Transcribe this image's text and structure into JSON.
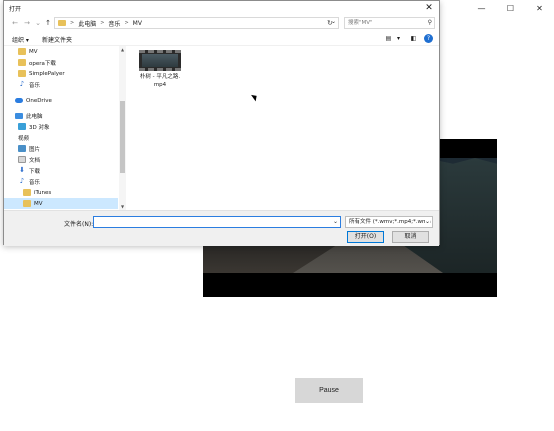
{
  "app": {
    "window_controls": [
      "—",
      "☐",
      "✕"
    ],
    "pause_label": "Pause"
  },
  "dialog": {
    "title": "打开",
    "close_glyph": "✕",
    "nav": {
      "back": "←",
      "forward": "→",
      "recent": "⌄",
      "up": "↑"
    },
    "address": {
      "crumbs": [
        "此电脑",
        "音乐",
        "MV"
      ],
      "sep": ">"
    },
    "refresh": "↻",
    "search_placeholder": "搜索\"MV\"",
    "toolbar": {
      "organize": "组织 ▾",
      "new_folder": "新建文件夹",
      "help": "?"
    },
    "nav_items": [
      {
        "label": "MV",
        "icon": "folder-icon"
      },
      {
        "label": "opera下载",
        "icon": "folder-icon"
      },
      {
        "label": "SimplePalyer",
        "icon": "folder-icon"
      },
      {
        "label": "音乐",
        "icon": "music-icon"
      },
      {
        "label": "OneDrive",
        "icon": "cloud-icon"
      },
      {
        "label": "此电脑",
        "icon": "computer-icon"
      },
      {
        "label": "3D 对象",
        "icon": "cube-icon"
      },
      {
        "label": "视频",
        "icon": "video-icon"
      },
      {
        "label": "图片",
        "icon": "picture-icon"
      },
      {
        "label": "文档",
        "icon": "document-icon"
      },
      {
        "label": "下载",
        "icon": "download-icon"
      },
      {
        "label": "音乐",
        "icon": "music-icon"
      },
      {
        "label": "iTunes",
        "icon": "folder-icon"
      },
      {
        "label": "MV",
        "icon": "folder-icon"
      }
    ],
    "selected_nav": "MV",
    "files": [
      {
        "name_line1": "朴树 - 平凡之路.",
        "name_line2": "mp4"
      }
    ],
    "filename_label": "文件名(N):",
    "filename_value": "",
    "filetype_value": "所有文件 (*.wmv;*.mp4;*.wma",
    "open_label": "打开(O)",
    "cancel_label": "取消"
  }
}
